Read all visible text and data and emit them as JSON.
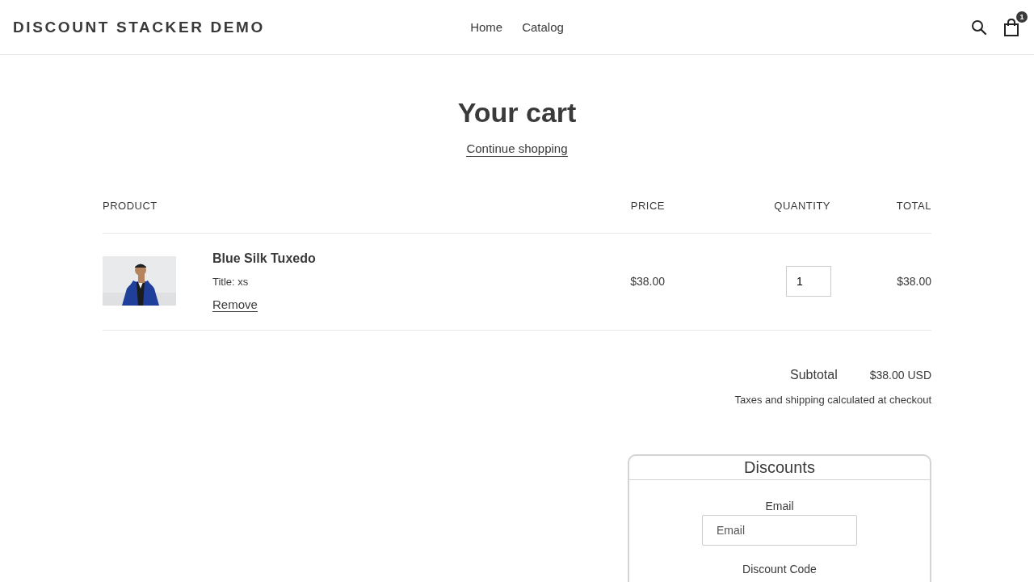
{
  "header": {
    "logo": "DISCOUNT STACKER DEMO",
    "nav": [
      {
        "label": "Home"
      },
      {
        "label": "Catalog"
      }
    ],
    "cart_count": "1"
  },
  "page": {
    "title": "Your cart",
    "continue_link": "Continue shopping"
  },
  "table": {
    "columns": [
      "PRODUCT",
      "PRICE",
      "QUANTITY",
      "TOTAL"
    ],
    "rows": [
      {
        "name": "Blue Silk Tuxedo",
        "variant": "Title: xs",
        "remove": "Remove",
        "price": "$38.00",
        "quantity": "1",
        "total": "$38.00"
      }
    ]
  },
  "summary": {
    "subtotal_label": "Subtotal",
    "subtotal_value": "$38.00 USD",
    "note": "Taxes and shipping calculated at checkout"
  },
  "discounts": {
    "title": "Discounts",
    "email_label": "Email",
    "email_placeholder": "Email",
    "code_label": "Discount Code"
  }
}
